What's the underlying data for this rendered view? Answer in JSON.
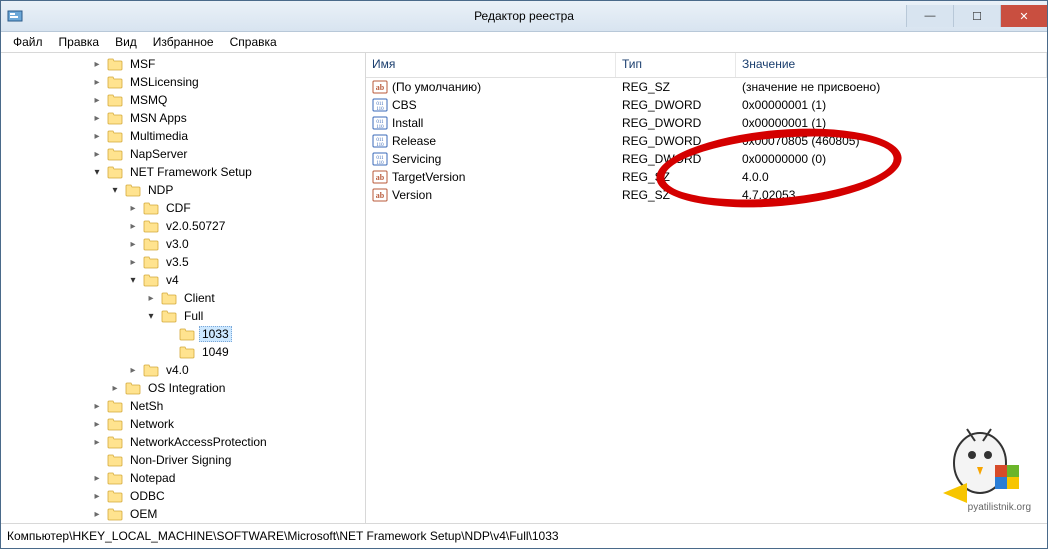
{
  "window": {
    "title": "Редактор реестра"
  },
  "menu": {
    "items": [
      "Файл",
      "Правка",
      "Вид",
      "Избранное",
      "Справка"
    ]
  },
  "tree": [
    {
      "label": "MSF",
      "indent": 5,
      "expander": "closed"
    },
    {
      "label": "MSLicensing",
      "indent": 5,
      "expander": "closed"
    },
    {
      "label": "MSMQ",
      "indent": 5,
      "expander": "closed"
    },
    {
      "label": "MSN Apps",
      "indent": 5,
      "expander": "closed"
    },
    {
      "label": "Multimedia",
      "indent": 5,
      "expander": "closed"
    },
    {
      "label": "NapServer",
      "indent": 5,
      "expander": "closed"
    },
    {
      "label": "NET Framework Setup",
      "indent": 5,
      "expander": "open"
    },
    {
      "label": "NDP",
      "indent": 6,
      "expander": "open"
    },
    {
      "label": "CDF",
      "indent": 7,
      "expander": "closed"
    },
    {
      "label": "v2.0.50727",
      "indent": 7,
      "expander": "closed"
    },
    {
      "label": "v3.0",
      "indent": 7,
      "expander": "closed"
    },
    {
      "label": "v3.5",
      "indent": 7,
      "expander": "closed"
    },
    {
      "label": "v4",
      "indent": 7,
      "expander": "open"
    },
    {
      "label": "Client",
      "indent": 8,
      "expander": "closed"
    },
    {
      "label": "Full",
      "indent": 8,
      "expander": "open"
    },
    {
      "label": "1033",
      "indent": 9,
      "expander": "none",
      "selected": true
    },
    {
      "label": "1049",
      "indent": 9,
      "expander": "none"
    },
    {
      "label": "v4.0",
      "indent": 7,
      "expander": "closed"
    },
    {
      "label": "OS Integration",
      "indent": 6,
      "expander": "closed"
    },
    {
      "label": "NetSh",
      "indent": 5,
      "expander": "closed"
    },
    {
      "label": "Network",
      "indent": 5,
      "expander": "closed"
    },
    {
      "label": "NetworkAccessProtection",
      "indent": 5,
      "expander": "closed"
    },
    {
      "label": "Non-Driver Signing",
      "indent": 5,
      "expander": "none"
    },
    {
      "label": "Notepad",
      "indent": 5,
      "expander": "closed"
    },
    {
      "label": "ODBC",
      "indent": 5,
      "expander": "closed"
    },
    {
      "label": "OEM",
      "indent": 5,
      "expander": "closed"
    }
  ],
  "list": {
    "headers": {
      "name": "Имя",
      "type": "Тип",
      "value": "Значение"
    },
    "rows": [
      {
        "icon": "sz",
        "name": "(По умолчанию)",
        "type": "REG_SZ",
        "value": "(значение не присвоено)"
      },
      {
        "icon": "dw",
        "name": "CBS",
        "type": "REG_DWORD",
        "value": "0x00000001 (1)"
      },
      {
        "icon": "dw",
        "name": "Install",
        "type": "REG_DWORD",
        "value": "0x00000001 (1)"
      },
      {
        "icon": "dw",
        "name": "Release",
        "type": "REG_DWORD",
        "value": "0x00070805 (460805)"
      },
      {
        "icon": "dw",
        "name": "Servicing",
        "type": "REG_DWORD",
        "value": "0x00000000 (0)"
      },
      {
        "icon": "sz",
        "name": "TargetVersion",
        "type": "REG_SZ",
        "value": "4.0.0"
      },
      {
        "icon": "sz",
        "name": "Version",
        "type": "REG_SZ",
        "value": "4.7.02053"
      }
    ]
  },
  "status": {
    "path": "Компьютер\\HKEY_LOCAL_MACHINE\\SOFTWARE\\Microsoft\\NET Framework Setup\\NDP\\v4\\Full\\1033"
  },
  "watermark": {
    "text": "pyatilistnik.org"
  }
}
